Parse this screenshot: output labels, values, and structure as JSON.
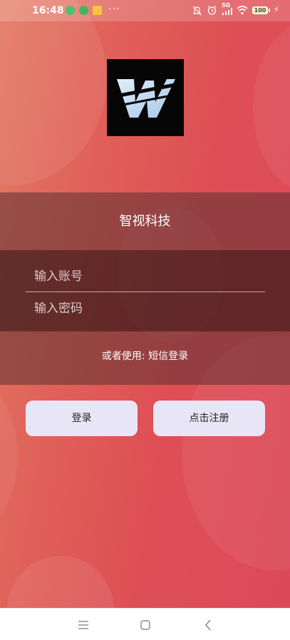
{
  "status_bar": {
    "time": "16:48",
    "notification_dots": "···",
    "signal_label": "5G",
    "battery_level": "100"
  },
  "app": {
    "title": "智视科技",
    "logo_letter": "W"
  },
  "login_form": {
    "account_placeholder": "输入账号",
    "password_placeholder": "输入密码",
    "alt_login_text": "或者使用: 短信登录"
  },
  "buttons": {
    "login": "登录",
    "register": "点击注册"
  },
  "nav_bar": {
    "menu_icon": "menu-icon",
    "home_icon": "home-icon",
    "back_icon": "back-icon"
  },
  "colors": {
    "background_start": "#e27a62",
    "background_end": "#dc4a59",
    "button_bg": "#e8e6f6"
  }
}
